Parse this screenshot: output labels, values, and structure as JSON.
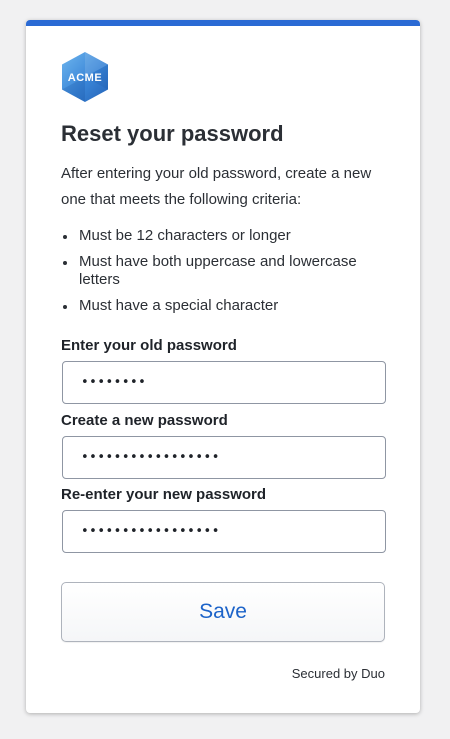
{
  "brand": {
    "logo_text": "ACME",
    "accent_color": "#2a6ad4"
  },
  "form": {
    "title": "Reset your password",
    "intro": "After entering your old password, create a new one that meets the following criteria:",
    "criteria": [
      "Must be 12 characters or longer",
      "Must have both uppercase and lowercase letters",
      "Must have a special character"
    ],
    "old_password": {
      "label": "Enter your old password",
      "value": "••••••••"
    },
    "new_password": {
      "label": "Create a new password",
      "value": "•••••••••••••••••"
    },
    "confirm_password": {
      "label": "Re-enter your new password",
      "value": "•••••••••••••••••"
    },
    "save_label": "Save"
  },
  "footer": {
    "secured_by": "Secured by Duo"
  }
}
